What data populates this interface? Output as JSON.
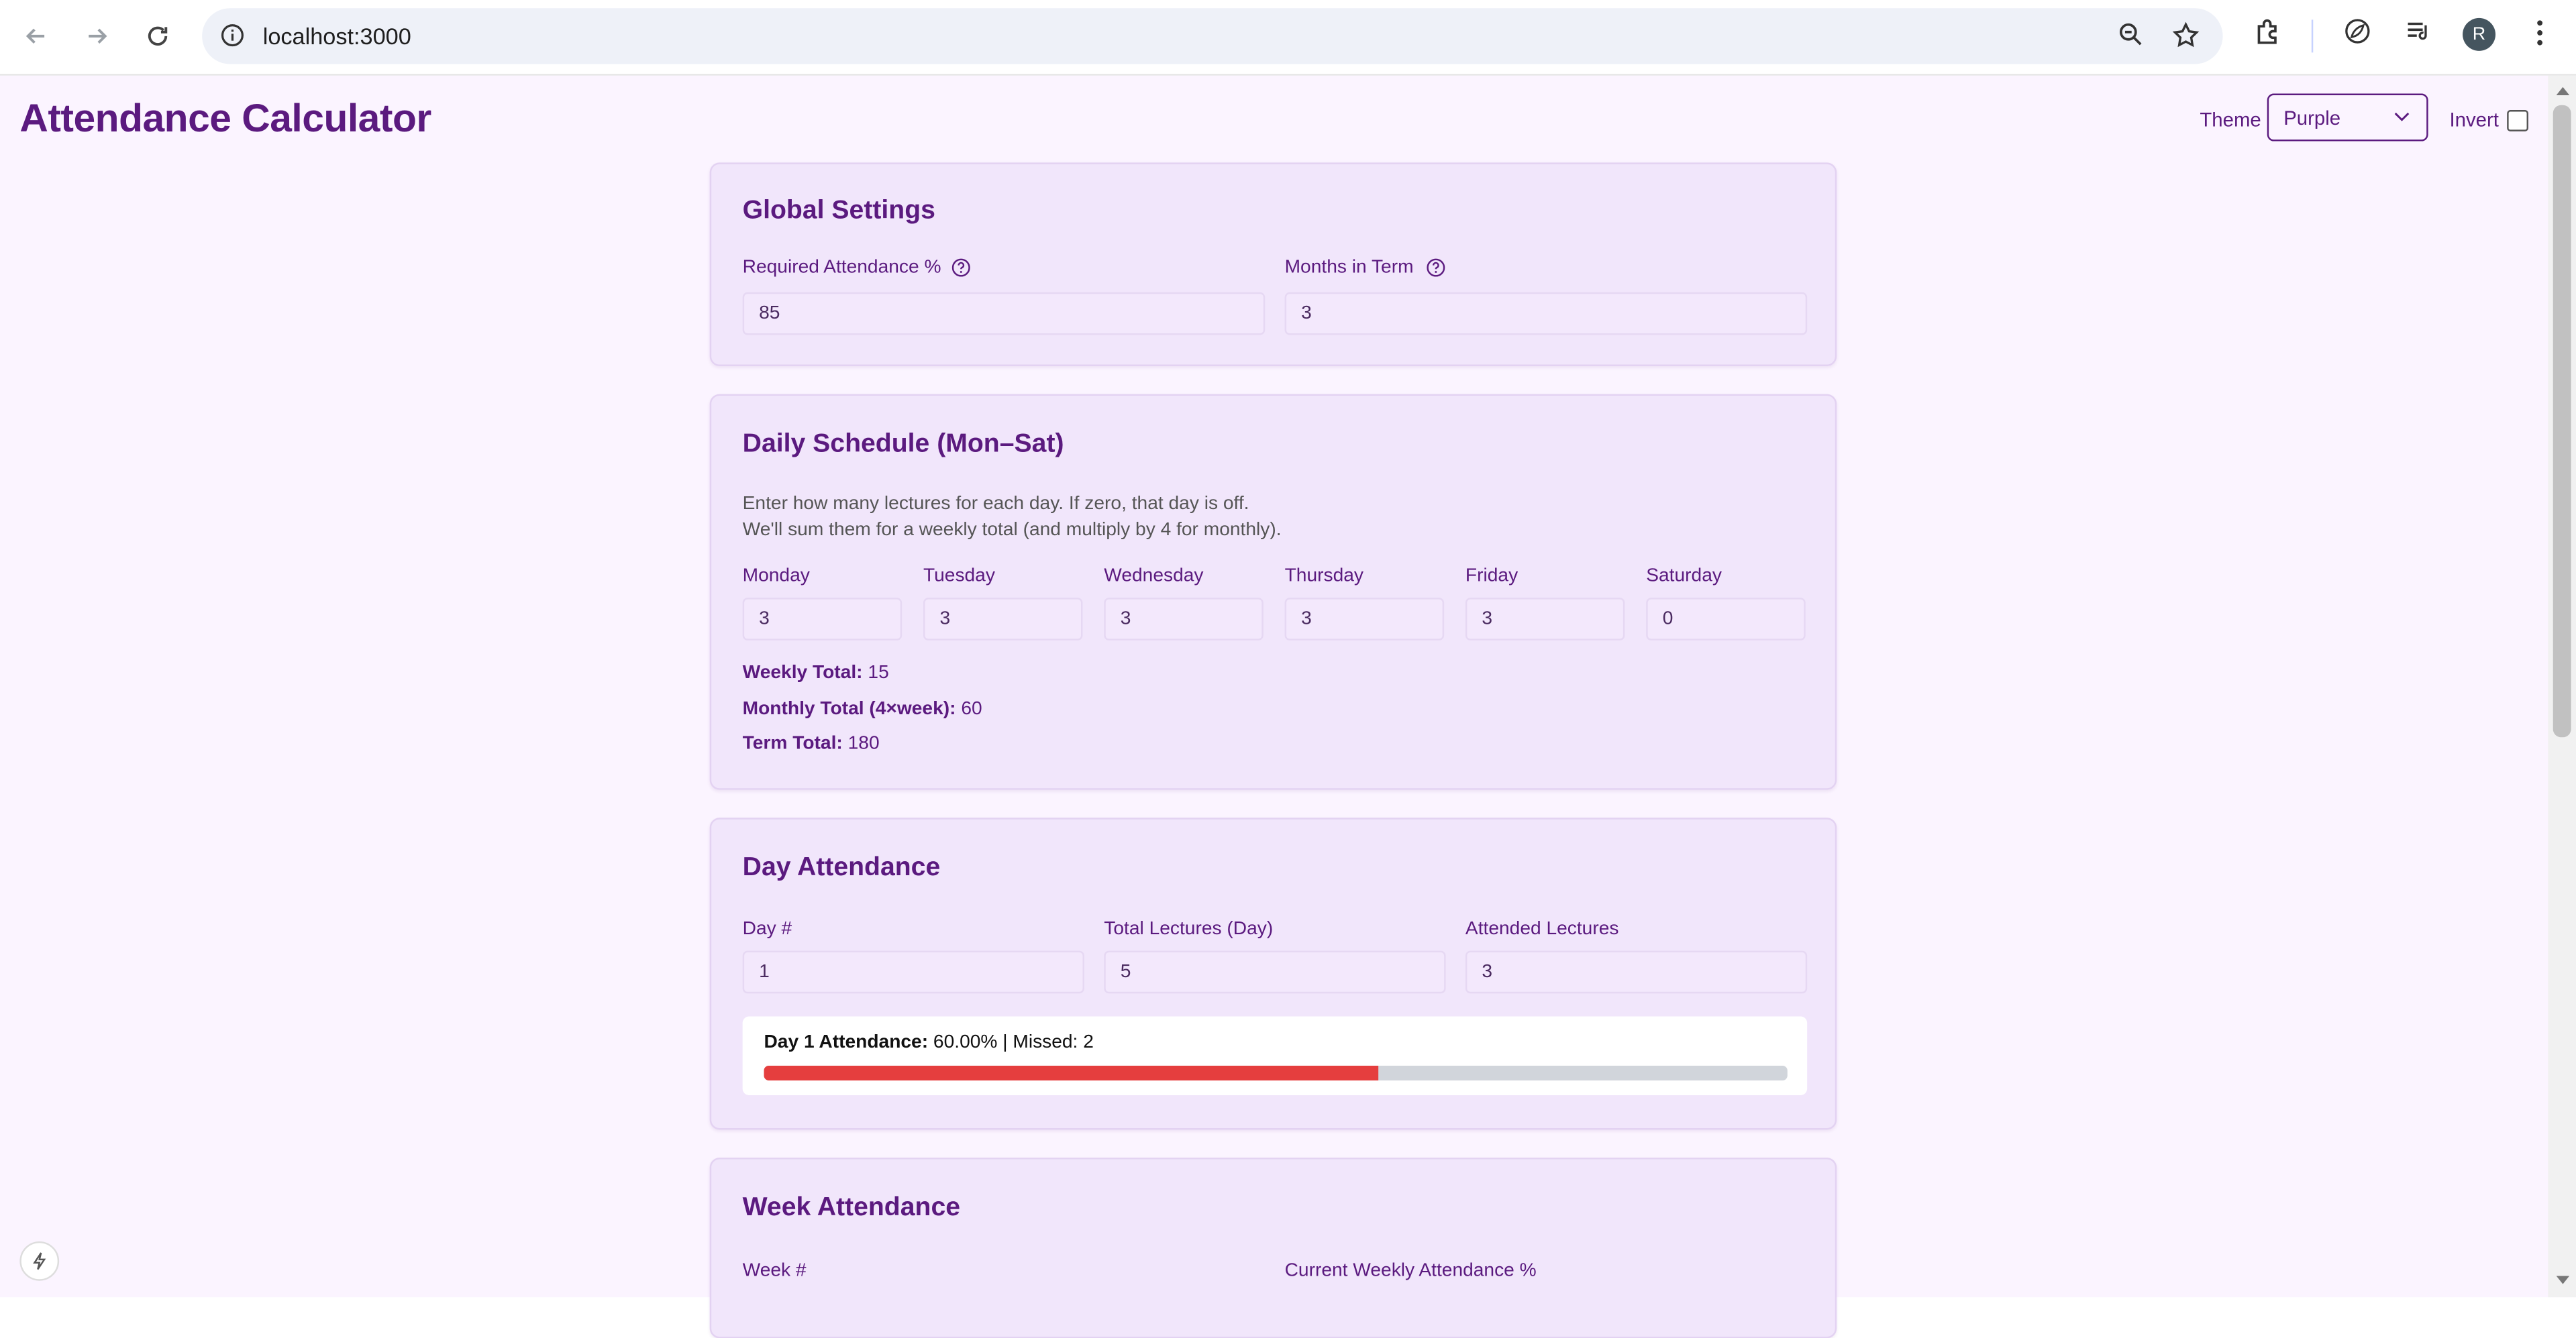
{
  "browser": {
    "url": "localhost:3000",
    "avatar_letter": "R"
  },
  "header": {
    "title": "Attendance Calculator",
    "theme_label": "Theme",
    "theme_value": "Purple",
    "invert_label": "Invert",
    "invert_checked": false
  },
  "global_settings": {
    "title": "Global Settings",
    "required_label": "Required Attendance %",
    "required_value": "85",
    "months_label": "Months in Term",
    "months_value": "3"
  },
  "daily_schedule": {
    "title": "Daily Schedule (Mon–Sat)",
    "desc_line1": "Enter how many lectures for each day. If zero, that day is off.",
    "desc_line2": "We'll sum them for a weekly total (and multiply by 4 for monthly).",
    "days": [
      {
        "label": "Monday",
        "value": "3"
      },
      {
        "label": "Tuesday",
        "value": "3"
      },
      {
        "label": "Wednesday",
        "value": "3"
      },
      {
        "label": "Thursday",
        "value": "3"
      },
      {
        "label": "Friday",
        "value": "3"
      },
      {
        "label": "Saturday",
        "value": "0"
      }
    ],
    "weekly_label": "Weekly Total:",
    "weekly_value": "15",
    "monthly_label": "Monthly Total (4×week):",
    "monthly_value": "60",
    "term_label": "Term Total:",
    "term_value": "180"
  },
  "day_attendance": {
    "title": "Day Attendance",
    "day_label": "Day #",
    "day_value": "1",
    "total_label": "Total Lectures (Day)",
    "total_value": "5",
    "attended_label": "Attended Lectures",
    "attended_value": "3",
    "result_label": "Day 1 Attendance:",
    "result_value": "60.00% | Missed: 2",
    "progress": 0.6,
    "progress_color": "#e53e3e"
  },
  "week_attendance": {
    "title": "Week Attendance",
    "week_label": "Week #",
    "current_label": "Current Weekly Attendance %"
  }
}
